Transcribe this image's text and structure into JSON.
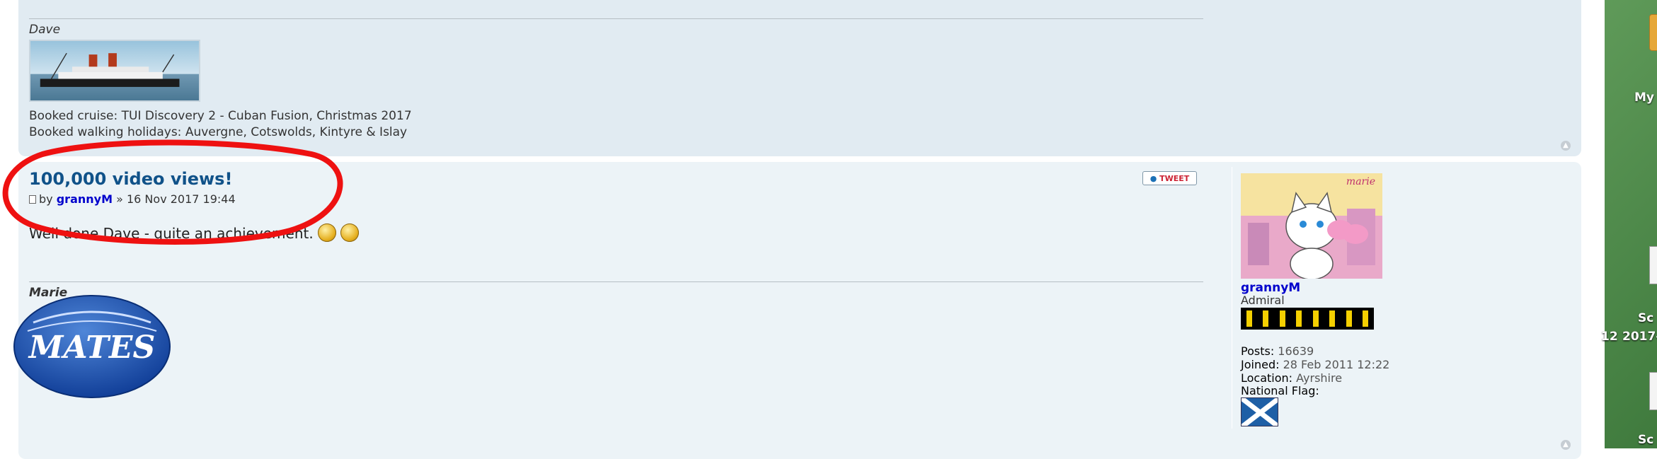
{
  "post1": {
    "sig_name": "Dave",
    "sig_lines": [
      "Booked cruise: TUI Discovery 2 - Cuban Fusion, Christmas 2017",
      "Booked walking holidays: Auvergne, Cotswolds, Kintyre & Islay"
    ]
  },
  "post2": {
    "title": "100,000 video views!",
    "by_label": "by",
    "author": "grannyM",
    "separator": "»",
    "date": "16 Nov 2017 19:44",
    "content": "Well done Dave - quite an achievement.",
    "tweet_label": "TWEET",
    "sig_name": "Marie",
    "sig_logo_text": "MATES",
    "avatar_caption": "marie"
  },
  "profile": {
    "username": "grannyM",
    "rank": "Admiral",
    "fields": [
      {
        "label": "Posts:",
        "value": "16639"
      },
      {
        "label": "Joined:",
        "value": "28 Feb 2011 12:22"
      },
      {
        "label": "Location:",
        "value": "Ayrshire"
      },
      {
        "label": "National Flag:",
        "value": ""
      }
    ]
  },
  "desktop": {
    "labels": [
      "My",
      "Sc",
      "2017-",
      "Sc"
    ],
    "partial_number": "12"
  },
  "colors": {
    "post_bg_dark": "#e1ebf2",
    "post_bg_light": "#ecf3f7",
    "title": "#105289",
    "author": "#0000cc",
    "annotation": "#ee1111"
  }
}
